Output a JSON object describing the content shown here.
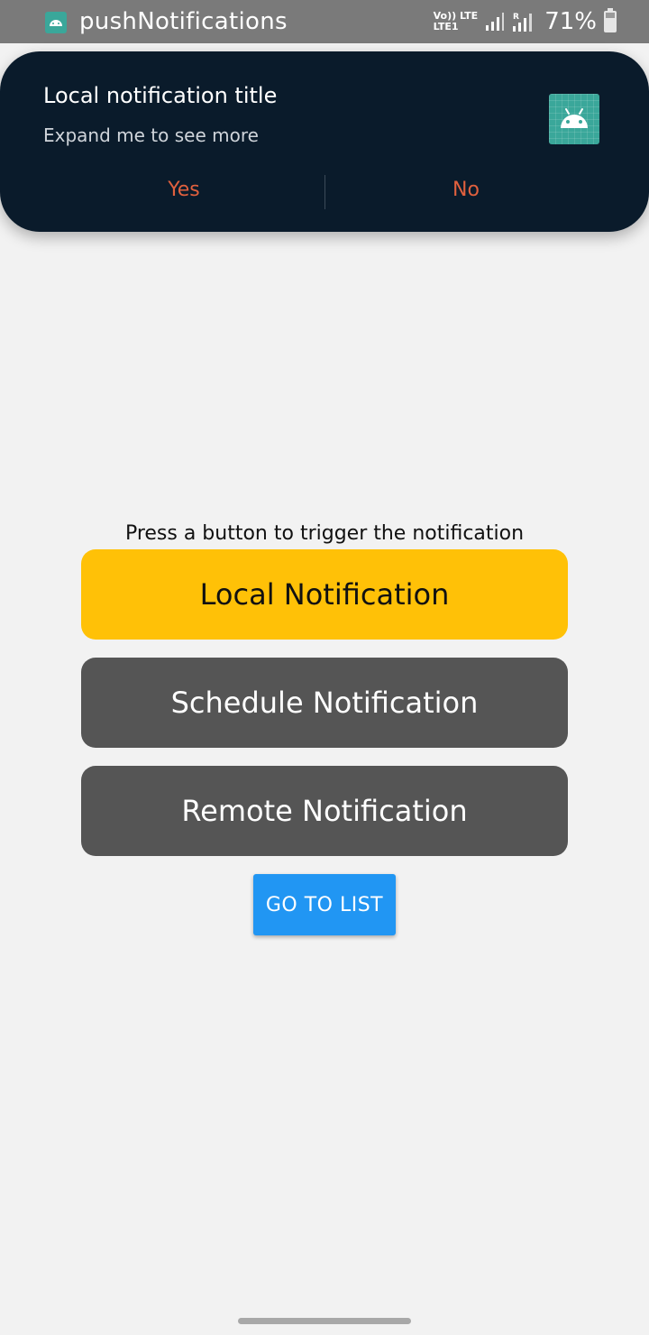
{
  "status_bar": {
    "app_name": "pushNotifications",
    "net_top": "Vo)) LTE",
    "net_bottom": "LTE1",
    "battery": "71%"
  },
  "notification": {
    "title": "Local notification title",
    "body": "Expand me to see more",
    "actions": [
      "Yes",
      "No"
    ],
    "icon": "android-icon"
  },
  "main": {
    "prompt": "Press a button to trigger the notification",
    "buttons": {
      "local": "Local Notification",
      "schedule": "Schedule Notification",
      "remote": "Remote Notification"
    },
    "list_button": "GO TO LIST"
  },
  "colors": {
    "notification_bg": "#0a1b2b",
    "action_text": "#e0603e",
    "local_button": "#ffc107",
    "secondary_button": "#555555",
    "list_button": "#2196f3",
    "app_icon": "#3aa79a"
  }
}
